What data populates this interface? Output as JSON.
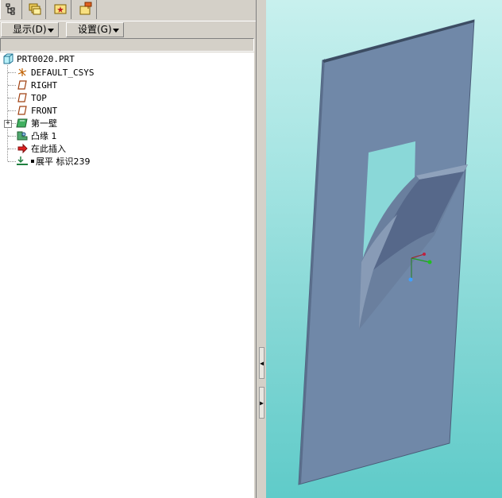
{
  "toolbar_tabs": [
    {
      "icon": "model-tree-icon"
    },
    {
      "icon": "folder-browser-icon"
    },
    {
      "icon": "favorites-icon"
    },
    {
      "icon": "connections-icon"
    }
  ],
  "menu": {
    "display_label": "显示(D)",
    "settings_label": "设置(G)"
  },
  "tree": {
    "root": "PRT0020.PRT",
    "items": [
      {
        "label": "DEFAULT_CSYS",
        "icon": "csys-icon"
      },
      {
        "label": "RIGHT",
        "icon": "datum-plane-icon"
      },
      {
        "label": "TOP",
        "icon": "datum-plane-icon"
      },
      {
        "label": "FRONT",
        "icon": "datum-plane-icon"
      },
      {
        "label": "第一壁",
        "icon": "sheetmetal-wall-icon"
      },
      {
        "label": "凸缘 1",
        "icon": "flange-icon"
      },
      {
        "label": "在此插入",
        "icon": "insert-here-arrow-icon"
      },
      {
        "label": "展平 标识239",
        "icon": "flatten-icon"
      }
    ]
  },
  "colors": {
    "viewport_top": "#c8f0ee",
    "viewport_bottom": "#5fcbc9",
    "part_face": "#7088a8",
    "part_edge": "#4a5c78"
  }
}
